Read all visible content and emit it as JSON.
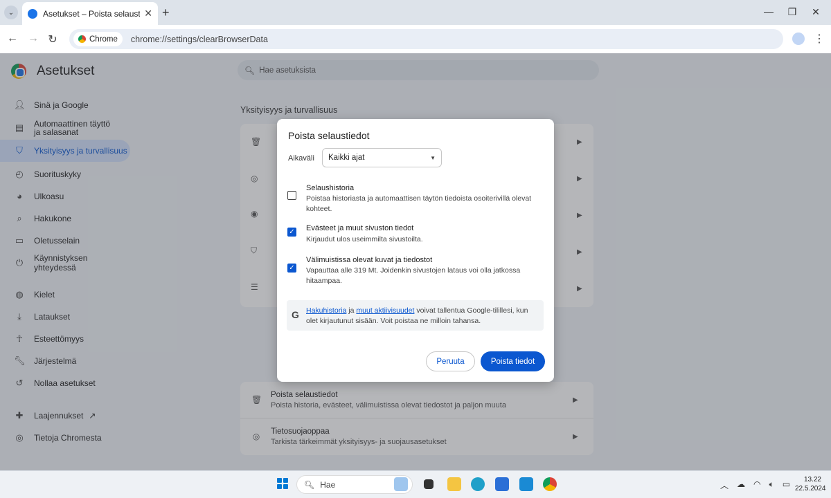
{
  "browser": {
    "tab_title": "Asetukset – Poista selaustiedot",
    "new_tab": "+",
    "chip_label": "Chrome",
    "url": "chrome://settings/clearBrowserData"
  },
  "settings": {
    "title": "Asetukset",
    "search_placeholder": "Hae asetuksista",
    "nav": [
      {
        "label": "Sinä ja Google",
        "icon": "person-icon"
      },
      {
        "label": "Automaattinen täyttö ja salasanat",
        "icon": "autofill-icon"
      },
      {
        "label": "Yksityisyys ja turvallisuus",
        "icon": "shield-icon",
        "active": true
      },
      {
        "label": "Suorituskyky",
        "icon": "speedometer-icon"
      },
      {
        "label": "Ulkoasu",
        "icon": "palette-icon"
      },
      {
        "label": "Hakukone",
        "icon": "search-icon"
      },
      {
        "label": "Oletusselain",
        "icon": "browser-icon"
      },
      {
        "label": "Käynnistyksen yhteydessä",
        "icon": "power-icon"
      },
      {
        "label": "Kielet",
        "icon": "globe-icon"
      },
      {
        "label": "Lataukset",
        "icon": "download-icon"
      },
      {
        "label": "Esteettömyys",
        "icon": "accessibility-icon"
      },
      {
        "label": "Järjestelmä",
        "icon": "wrench-icon"
      },
      {
        "label": "Nollaa asetukset",
        "icon": "reset-icon"
      },
      {
        "label": "Laajennukset",
        "icon": "puzzle-icon"
      },
      {
        "label": "Tietoja Chromesta",
        "icon": "chrome-icon"
      }
    ],
    "section_title": "Yksityisyys ja turvallisuus",
    "bottom_rows": [
      {
        "title": "Poista selaustiedot",
        "desc": "Poista historia, evästeet, välimuistissa olevat tiedostot ja paljon muuta"
      },
      {
        "title": "Tietosuojaoppaa",
        "desc": "Tarkista tärkeimmät yksityisyys- ja suojausasetukset"
      }
    ]
  },
  "dialog": {
    "title": "Poista selaustiedot",
    "range_label": "Aikaväli",
    "range_value": "Kaikki ajat",
    "options": [
      {
        "title": "Selaushistoria",
        "desc": "Poistaa historiasta ja automaattisen täytön tiedoista osoiterivillä olevat kohteet.",
        "checked": false
      },
      {
        "title": "Evästeet ja muut sivuston tiedot",
        "desc": "Kirjaudut ulos useimmilta sivustoilta.",
        "checked": true
      },
      {
        "title": "Välimuistissa olevat kuvat ja tiedostot",
        "desc": "Vapauttaa alle 319 Mt. Joidenkin sivustojen lataus voi olla jatkossa hitaampaa.",
        "checked": true
      }
    ],
    "info_link1": "Hakuhistoria",
    "info_and": " ja ",
    "info_link2": "muut aktiivisuudet",
    "info_rest": " voivat tallentua Google-tilillesi, kun olet kirjautunut sisään. Voit poistaa ne milloin tahansa.",
    "cancel": "Peruuta",
    "confirm": "Poista tiedot"
  },
  "taskbar": {
    "search": "Hae",
    "time": "13.22",
    "date": "22.5.2024"
  },
  "colors": {
    "accent": "#0b57d0",
    "nav_active_bg": "#d3e3fd"
  }
}
